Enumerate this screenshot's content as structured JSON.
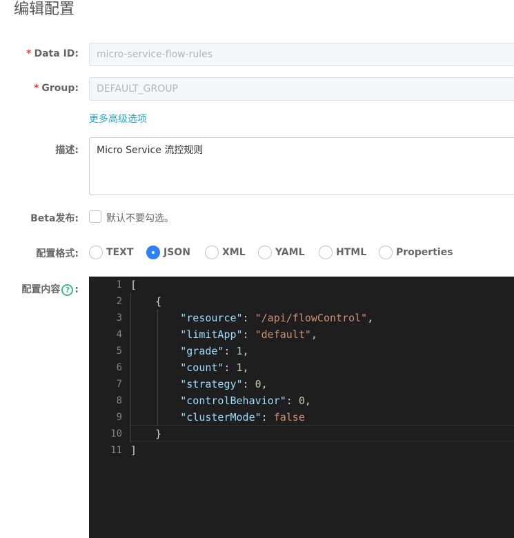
{
  "page": {
    "title": "编辑配置"
  },
  "form": {
    "data_id": {
      "label": "Data ID:",
      "required_mark": "*",
      "value": "micro-service-flow-rules"
    },
    "group": {
      "label": "Group:",
      "required_mark": "*",
      "value": "DEFAULT_GROUP"
    },
    "advanced_link": "更多高级选项",
    "description": {
      "label": "描述:",
      "value": "Micro Service 流控规则"
    },
    "beta": {
      "label": "Beta发布:",
      "checkbox_text": "默认不要勾选。",
      "checked": false
    },
    "format": {
      "label": "配置格式:",
      "options": [
        "TEXT",
        "JSON",
        "XML",
        "YAML",
        "HTML",
        "Properties"
      ],
      "selected": "JSON"
    },
    "content": {
      "label_prefix": "配置内容",
      "help_glyph": "?",
      "label_suffix": ":"
    }
  },
  "editor": {
    "line_numbers": [
      "1",
      "2",
      "3",
      "4",
      "5",
      "6",
      "7",
      "8",
      "9",
      "10",
      "11"
    ],
    "lines": [
      "[",
      "    {",
      "        \"resource\": \"/api/flowControl\",",
      "        \"limitApp\": \"default\",",
      "        \"grade\": 1,",
      "        \"count\": 1,",
      "        \"strategy\": 0,",
      "        \"controlBehavior\": 0,",
      "        \"clusterMode\": false",
      "    }",
      "]"
    ],
    "current_line": 10
  },
  "colors": {
    "accent": "#2f7ff5",
    "link": "#2aa5c8",
    "required": "#e0463a",
    "help_icon": "#41b883",
    "editor_bg": "#1e1e1e"
  },
  "icons": {
    "help": "question-circle-icon"
  }
}
